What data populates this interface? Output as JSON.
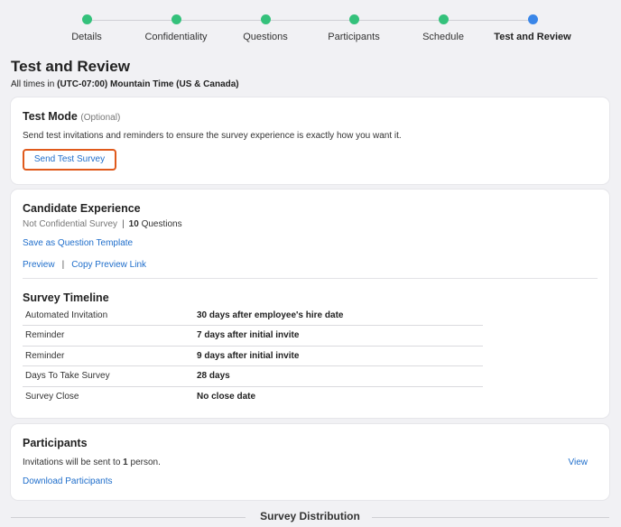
{
  "stepper": {
    "steps": [
      {
        "label": "Details",
        "color": "#34c17b"
      },
      {
        "label": "Confidentiality",
        "color": "#34c17b"
      },
      {
        "label": "Questions",
        "color": "#34c17b"
      },
      {
        "label": "Participants",
        "color": "#34c17b"
      },
      {
        "label": "Schedule",
        "color": "#34c17b"
      },
      {
        "label": "Test and Review",
        "color": "#3a86e8"
      }
    ]
  },
  "page": {
    "title": "Test and Review",
    "tz_prefix": "All times in ",
    "tz_value": "(UTC-07:00) Mountain Time (US & Canada)"
  },
  "test_mode": {
    "title": "Test Mode",
    "optional": "(Optional)",
    "description": "Send test invitations and reminders to ensure the survey experience is exactly how you want it.",
    "button": "Send Test Survey"
  },
  "candidate": {
    "title": "Candidate Experience",
    "confidentiality": "Not Confidential Survey",
    "separator": "|",
    "question_count": "10",
    "question_label": " Questions",
    "save_template": "Save as Question Template",
    "preview": "Preview",
    "copy_preview": "Copy Preview Link"
  },
  "timeline": {
    "title": "Survey Timeline",
    "rows": [
      {
        "key": "Automated Invitation",
        "value": "30 days after employee's hire date"
      },
      {
        "key": "Reminder",
        "value": "7 days after initial invite"
      },
      {
        "key": "Reminder",
        "value": "9 days after initial invite"
      },
      {
        "key": "Days To Take Survey",
        "value": "28 days"
      },
      {
        "key": "Survey Close",
        "value": "No close date"
      }
    ]
  },
  "participants": {
    "title": "Participants",
    "inv_prefix": "Invitations will be sent to ",
    "count": "1",
    "inv_suffix": " person.",
    "view": "View",
    "download": "Download Participants"
  },
  "distribution": {
    "title": "Survey Distribution"
  }
}
